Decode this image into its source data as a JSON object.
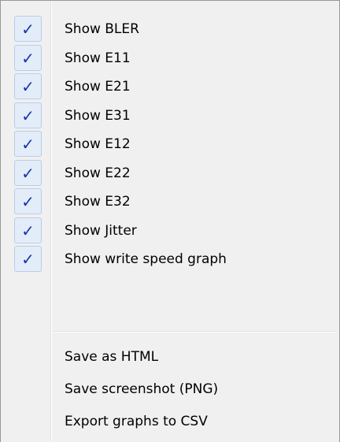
{
  "menu": {
    "checked_items": [
      {
        "label": "Show BLER",
        "checked": true
      },
      {
        "label": "Show E11",
        "checked": true
      },
      {
        "label": "Show E21",
        "checked": true
      },
      {
        "label": "Show E31",
        "checked": true
      },
      {
        "label": "Show E12",
        "checked": true
      },
      {
        "label": "Show E22",
        "checked": true
      },
      {
        "label": "Show E32",
        "checked": true
      },
      {
        "label": "Show Jitter",
        "checked": true
      },
      {
        "label": "Show write speed graph",
        "checked": true
      }
    ],
    "check_glyph": "✓",
    "action_items": [
      {
        "label": "Save as HTML"
      },
      {
        "label": "Save screenshot (PNG)"
      },
      {
        "label": "Export graphs to CSV"
      }
    ]
  },
  "colors": {
    "menu_background": "#f0f0f0",
    "checkmark": "#1a35a8",
    "check_highlight": "#e3edf9"
  },
  "icons": {
    "check": "checkmark-icon"
  }
}
